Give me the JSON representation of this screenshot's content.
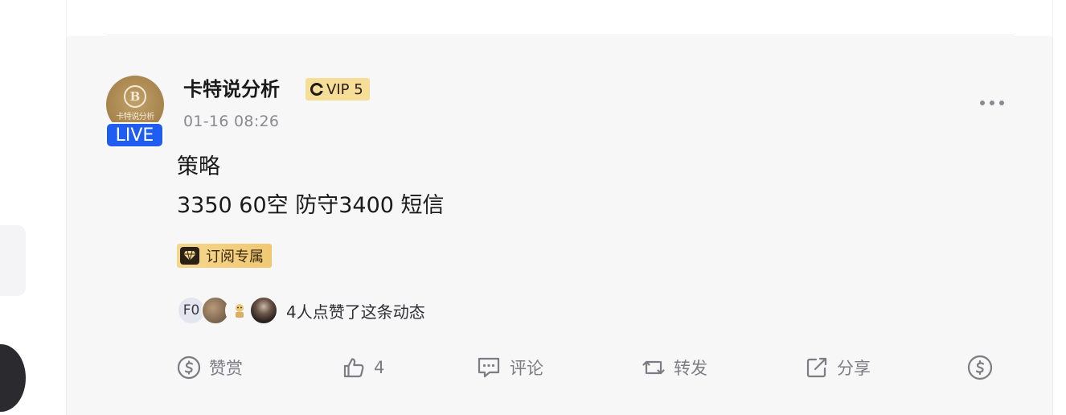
{
  "author": {
    "name": "卡特说分析",
    "avatar_text": "卡特说分析",
    "avatar_logo": "B",
    "live_label": "LIVE",
    "vip_label": "VIP 5",
    "time": "01-16 08:26"
  },
  "post": {
    "lines": [
      "策略",
      "3350 60空 防守3400 短信"
    ],
    "subscription_badge": "订阅专属"
  },
  "likes": {
    "first_avatar_text": "F0",
    "summary": "4人点赞了这条动态"
  },
  "actions": {
    "reward_label": "赞赏",
    "like_count": "4",
    "comment_label": "评论",
    "repost_label": "转发",
    "share_label": "分享"
  },
  "icons": {
    "more": "more-horizontal-icon",
    "reward": "reward-coin-icon",
    "like": "thumbs-up-icon",
    "comment": "comment-icon",
    "repost": "repost-icon",
    "share": "share-icon",
    "tip": "dollar-icon",
    "vip": "vip-icon",
    "subscription": "diamond-icon"
  },
  "colors": {
    "live": "#1f5cf2",
    "vip_bg": "#f6dd98",
    "card_bg": "#f7f7f8",
    "muted": "#7c7c82"
  }
}
